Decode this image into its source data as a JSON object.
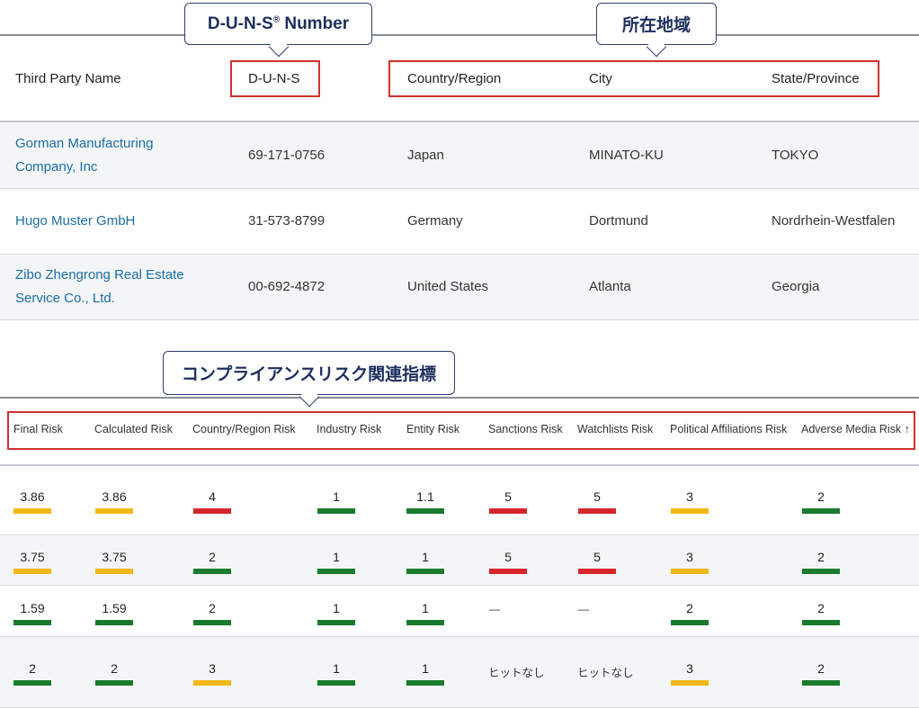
{
  "callouts": {
    "duns_title": "D-U-N-S",
    "duns_reg": "®",
    "duns_suffix": " Number",
    "location": "所在地域",
    "compliance": "コンプライアンスリスク関連指標"
  },
  "third_party_table": {
    "headers": [
      "Third Party Name",
      "D-U-N-S",
      "Country/Region",
      "City",
      "State/Province"
    ],
    "rows": [
      {
        "name_line1": "Gorman Manufacturing",
        "name_line2": "Company, Inc",
        "duns": "69-171-0756",
        "country": "Japan",
        "city": "MINATO-KU",
        "state": "TOKYO"
      },
      {
        "name_line1": "Hugo Muster GmbH",
        "name_line2": "",
        "duns": "31-573-8799",
        "country": "Germany",
        "city": "Dortmund",
        "state": "Nordrhein-Westfalen"
      },
      {
        "name_line1": "Zibo Zhengrong Real Estate",
        "name_line2": "Service Co., Ltd.",
        "duns": "00-692-4872",
        "country": "United States",
        "city": "Atlanta",
        "state": "Georgia"
      }
    ]
  },
  "risk_table": {
    "headers": [
      "Final Risk",
      "Calculated Risk",
      "Country/Region Risk",
      "Industry Risk",
      "Entity Risk",
      "Sanctions Risk",
      "Watchlists Risk",
      "Political Affiliations Risk",
      "Adverse Media Risk"
    ],
    "sort_indicator": "↑",
    "no_hit_text": "ヒットなし",
    "dash_text": "—",
    "rows": [
      [
        "3.86",
        "3.86",
        "4",
        "1",
        "1.1",
        "5",
        "5",
        "3",
        "2"
      ],
      [
        "3.75",
        "3.75",
        "2",
        "1",
        "1",
        "5",
        "5",
        "3",
        "2"
      ],
      [
        "1.59",
        "1.59",
        "2",
        "1",
        "1",
        "—",
        "—",
        "2",
        "2"
      ],
      [
        "2",
        "2",
        "3",
        "1",
        "1",
        "ヒットなし",
        "ヒットなし",
        "3",
        "2"
      ]
    ],
    "levels": [
      [
        "yellow",
        "yellow",
        "red",
        "green",
        "green",
        "red",
        "red",
        "yellow",
        "green"
      ],
      [
        "yellow",
        "yellow",
        "green",
        "green",
        "green",
        "red",
        "red",
        "yellow",
        "green"
      ],
      [
        "green",
        "green",
        "green",
        "green",
        "green",
        "none",
        "none",
        "green",
        "green"
      ],
      [
        "green",
        "green",
        "yellow",
        "green",
        "green",
        "none",
        "none",
        "yellow",
        "green"
      ]
    ]
  },
  "colors": {
    "accent_link": "#1a6ea8",
    "highlight_box": "#d0312d",
    "callout_text": "#1d2f5e",
    "green": "#1a7a2e",
    "yellow": "#f2b916",
    "red": "#d7262b"
  }
}
